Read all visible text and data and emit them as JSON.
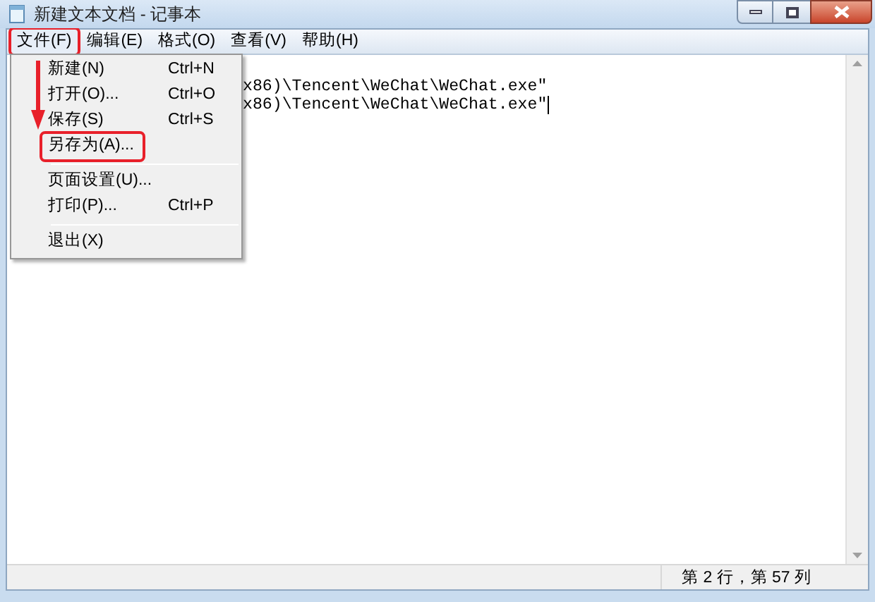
{
  "window": {
    "title": "新建文本文档 - 记事本"
  },
  "menu_bar": [
    {
      "label": "文件(F)",
      "selected": true,
      "annotated": true
    },
    {
      "label": "编辑(E)",
      "selected": false,
      "annotated": false
    },
    {
      "label": "格式(O)",
      "selected": false,
      "annotated": false
    },
    {
      "label": "查看(V)",
      "selected": false,
      "annotated": false
    },
    {
      "label": "帮助(H)",
      "selected": false,
      "annotated": false
    }
  ],
  "file_menu": [
    {
      "kind": "item",
      "label": "新建(N)",
      "shortcut": "Ctrl+N",
      "annotated": false
    },
    {
      "kind": "item",
      "label": "打开(O)...",
      "shortcut": "Ctrl+O",
      "annotated": false
    },
    {
      "kind": "item",
      "label": "保存(S)",
      "shortcut": "Ctrl+S",
      "annotated": false
    },
    {
      "kind": "item",
      "label": "另存为(A)...",
      "annotated": true
    },
    {
      "kind": "separator"
    },
    {
      "kind": "item",
      "label": "页面设置(U)...",
      "annotated": false
    },
    {
      "kind": "item",
      "label": "打印(P)...",
      "shortcut": "Ctrl+P",
      "annotated": false
    },
    {
      "kind": "separator"
    },
    {
      "kind": "item",
      "label": "退出(X)",
      "annotated": false
    }
  ],
  "editor": {
    "lines": [
      {
        "text": "x86)\\Tencent\\WeChat\\WeChat.exe\"",
        "cursor": false
      },
      {
        "text": "x86)\\Tencent\\WeChat\\WeChat.exe\"",
        "cursor": true
      }
    ]
  },
  "status_bar": {
    "position": "第 2 行，第 57 列"
  }
}
